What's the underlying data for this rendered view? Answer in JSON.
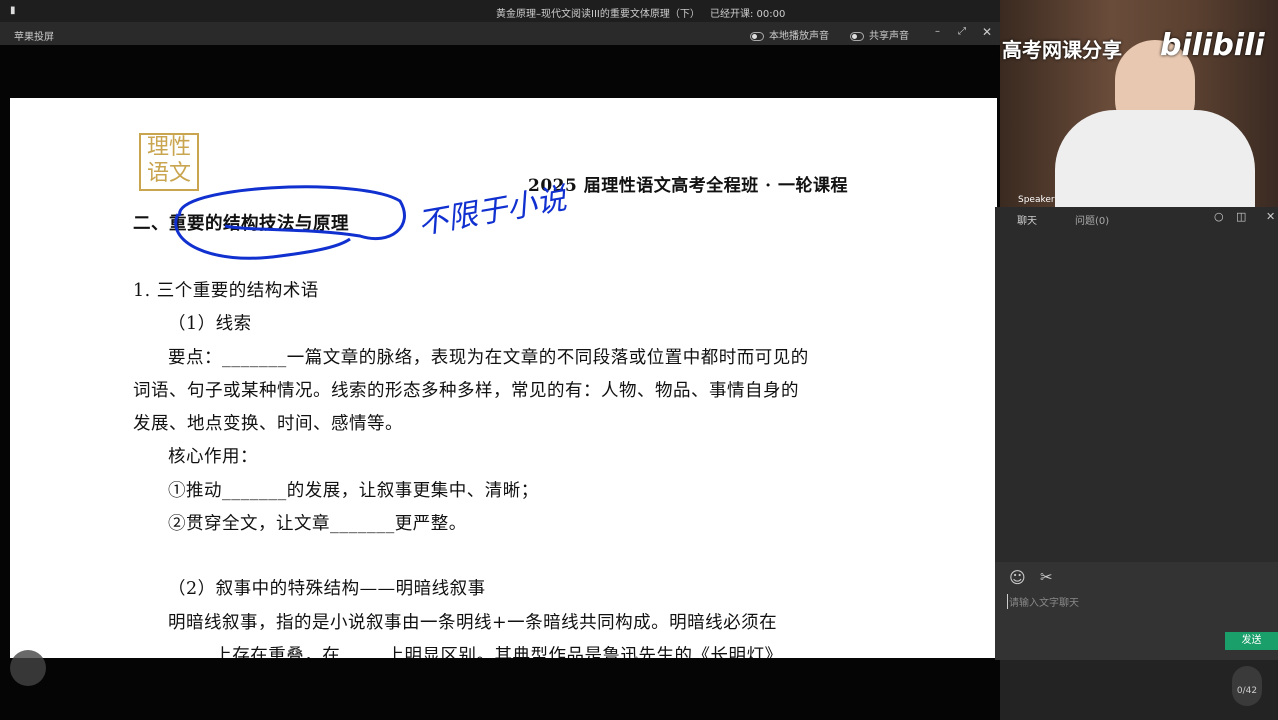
{
  "window": {
    "title": "黄金原理–现代文阅读III的重要文体原理（下）",
    "timer_label": "已经开课: 00:00",
    "app_name": "苹果投屏",
    "local_audio": "本地播放声音",
    "share_audio": "共享声音"
  },
  "webcam": {
    "overlay": "高考网课分享",
    "brand": "bilibili",
    "speaker": "Speaker"
  },
  "chat": {
    "tab_chat": "聊天",
    "tab_questions": "问题(0)",
    "placeholder": "请输入文字聊天",
    "send": "发送",
    "page_count": "0/42"
  },
  "doc": {
    "logo": "理性语文",
    "header": "2025 届理性语文高考全程班 · 一轮课程",
    "section_prefix": "二、",
    "section_title": "重要的结构技法与原理",
    "handwriting": "不限于小说",
    "lines": [
      "1. 三个重要的结构术语",
      "（1）线索",
      "要点：_______一篇文章的脉络，表现为在文章的不同段落或位置中都时而可见的",
      "词语、句子或某种情况。线索的形态多种多样，常见的有：人物、物品、事情自身的",
      "发展、地点变换、时间、感情等。",
      "核心作用：",
      "①推动_______的发展，让叙事更集中、清晰；",
      "②贯穿全文，让文章_______更严整。",
      "（2）叙事中的特殊结构——明暗线叙事",
      "明暗线叙事，指的是小说叙事由一条明线+一条暗线共同构成。明暗线必须在",
      "_____上存在重叠，在_____上明显区别。其典型作品是鲁迅先生的《长明灯》"
    ]
  },
  "colors": {
    "send": "#1a9e6a",
    "ink": "#1030d0",
    "logo": "#c9a550"
  }
}
